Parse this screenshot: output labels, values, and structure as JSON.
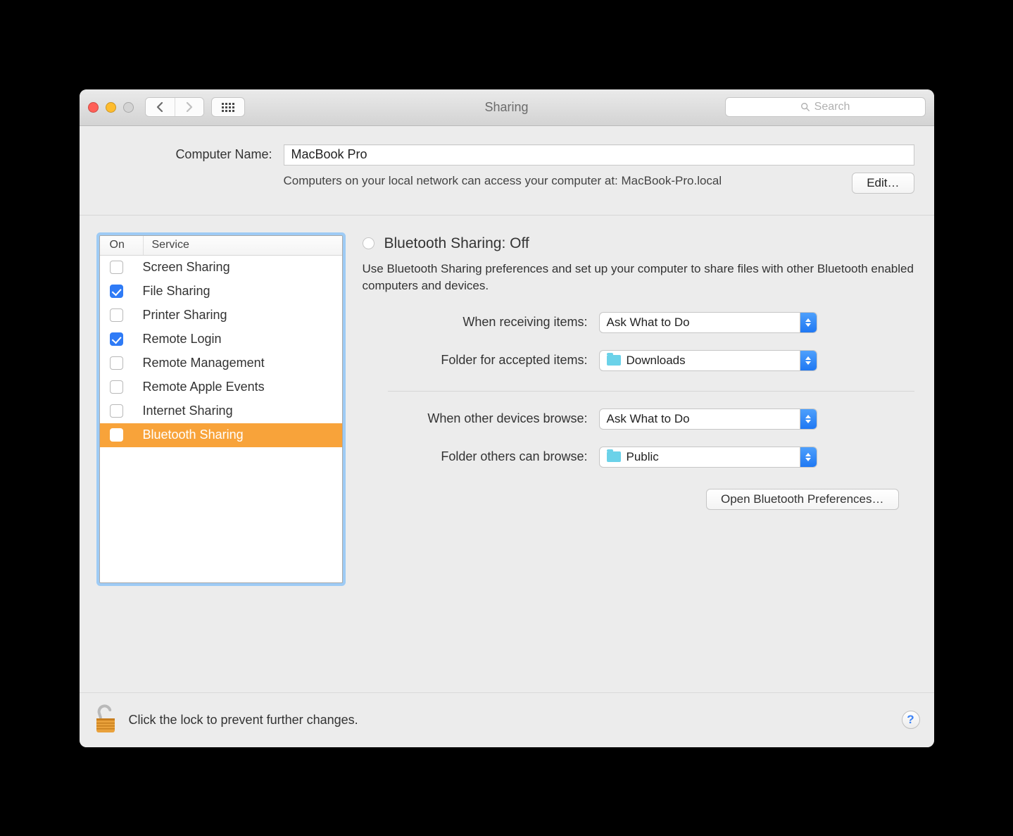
{
  "window_title": "Sharing",
  "search_placeholder": "Search",
  "computer_name": {
    "label": "Computer Name:",
    "value": "MacBook Pro",
    "description": "Computers on your local network can access your computer at: MacBook-Pro.local",
    "edit_button": "Edit…"
  },
  "services": {
    "col_on": "On",
    "col_service": "Service",
    "items": [
      {
        "name": "Screen Sharing",
        "on": false,
        "selected": false
      },
      {
        "name": "File Sharing",
        "on": true,
        "selected": false
      },
      {
        "name": "Printer Sharing",
        "on": false,
        "selected": false
      },
      {
        "name": "Remote Login",
        "on": true,
        "selected": false
      },
      {
        "name": "Remote Management",
        "on": false,
        "selected": false
      },
      {
        "name": "Remote Apple Events",
        "on": false,
        "selected": false
      },
      {
        "name": "Internet Sharing",
        "on": false,
        "selected": false
      },
      {
        "name": "Bluetooth Sharing",
        "on": false,
        "selected": true
      }
    ]
  },
  "detail": {
    "heading": "Bluetooth Sharing: Off",
    "description": "Use Bluetooth Sharing preferences and set up your computer to share files with other Bluetooth enabled computers and devices.",
    "receiving_label": "When receiving items:",
    "receiving_value": "Ask What to Do",
    "accepted_folder_label": "Folder for accepted items:",
    "accepted_folder_value": "Downloads",
    "browse_label": "When other devices browse:",
    "browse_value": "Ask What to Do",
    "browse_folder_label": "Folder others can browse:",
    "browse_folder_value": "Public",
    "open_bt_prefs": "Open Bluetooth Preferences…"
  },
  "footer": {
    "lock_message": "Click the lock to prevent further changes."
  }
}
